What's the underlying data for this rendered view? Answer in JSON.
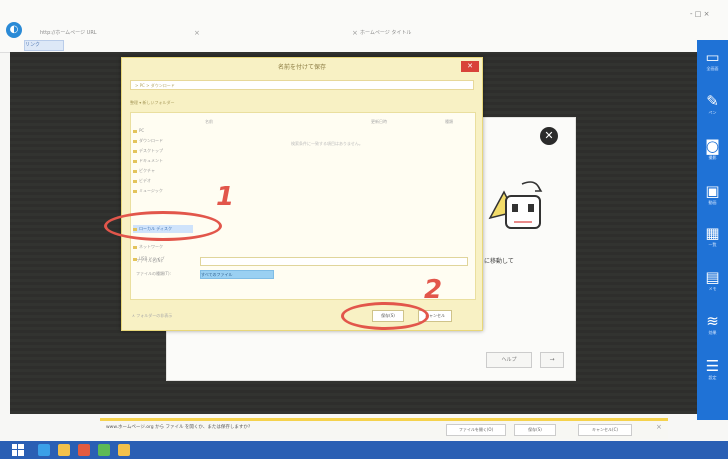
{
  "browser": {
    "tab1_text": "http://ホームページ URL",
    "tab2_text": "ホームページ タイトル",
    "address_text": "リンク",
    "win_controls": "- □ ×"
  },
  "toolbar": {
    "items": [
      {
        "icon": "display-icon",
        "glyph": "▭",
        "label": "全画面"
      },
      {
        "icon": "pen-icon",
        "glyph": "✎",
        "label": "ペン"
      },
      {
        "icon": "camera-icon",
        "glyph": "◙",
        "label": "撮影"
      },
      {
        "icon": "film-icon",
        "glyph": "▣",
        "label": "動画"
      },
      {
        "icon": "grid-icon",
        "glyph": "▦",
        "label": "一覧"
      },
      {
        "icon": "memo-icon",
        "glyph": "▤",
        "label": "メモ"
      },
      {
        "icon": "wave-icon",
        "glyph": "≋",
        "label": "効果"
      },
      {
        "icon": "stack-icon",
        "glyph": "☰",
        "label": "設定"
      }
    ]
  },
  "modal": {
    "close_glyph": "✕",
    "move_text": "に移動して",
    "help_label": "ヘルプ",
    "next_label": "→"
  },
  "file_dialog": {
    "title": "名前を付けて保存",
    "close_glyph": "✕",
    "path_text": "> PC > ダウンロード",
    "toolbar_text": "整理 ▾   新しいフォルダー",
    "col_name": "名前",
    "col_date": "更新日時",
    "col_type": "種類",
    "empty_note": "検索条件に一致する項目はありません。",
    "tree": [
      {
        "label": "PC"
      },
      {
        "label": "ダウンロード"
      },
      {
        "label": "デスクトップ"
      },
      {
        "label": "ドキュメント"
      },
      {
        "label": "ピクチャ"
      },
      {
        "label": "ビデオ"
      },
      {
        "label": "ミュージック"
      },
      {
        "label": "ローカル ディスク",
        "selected": true
      },
      {
        "label": "ネットワーク"
      },
      {
        "label": "USB ドライブ"
      }
    ],
    "filename_label": "ファイル名(N):",
    "filetype_label": "ファイルの種類(T):",
    "filetype_value": "すべてのファイル",
    "hide_folders": "∧ フォルダーの非表示",
    "save_label": "保存(S)",
    "cancel_label": "キャンセル"
  },
  "annotations": {
    "num1": "1",
    "num2": "2",
    "color": "#e2564b"
  },
  "download_bar": {
    "text": "www.ホームページ.org から ファイル を開くか、または保存しますか?",
    "open_label": "ファイルを開く(O)",
    "save_label": "保存(S)",
    "cancel_label": "キャンセル(C)",
    "close_glyph": "×"
  },
  "colors": {
    "accent": "#1f72d6",
    "dialog_bg": "#f8f1c4",
    "annotation": "#e2564b",
    "taskbar": "#2a5fb4"
  }
}
